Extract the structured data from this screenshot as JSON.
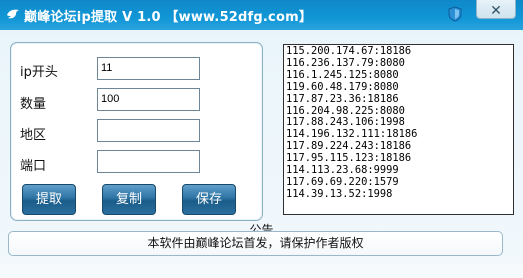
{
  "window": {
    "title": "巅峰论坛ip提取 V 1.0 【www.52dfg.com】",
    "app_icon": "bird-icon",
    "tray_icon": "shield-icon",
    "close_icon": "close-icon",
    "close_glyph": "✕"
  },
  "form": {
    "ip_prefix_label": "ip开头",
    "ip_prefix_value": "11",
    "count_label": "数量",
    "count_value": "100",
    "region_label": "地区",
    "region_value": "",
    "port_label": "端口",
    "port_value": ""
  },
  "buttons": {
    "extract": "提取",
    "copy": "复制",
    "save": "保存"
  },
  "output_lines": [
    "115.200.174.67:18186",
    "116.236.137.79:8080",
    "116.1.245.125:8080",
    "119.60.48.179:8080",
    "117.87.23.36:18186",
    "116.204.98.225:8080",
    "117.88.243.106:1998",
    "114.196.132.111:18186",
    "117.89.224.243:18186",
    "117.95.115.123:18186",
    "114.113.23.68:9999",
    "117.69.69.220:1579",
    "114.39.13.52:1998"
  ],
  "notice": {
    "title": "公告",
    "text": "本软件由巅峰论坛首发，请保护作者版权"
  }
}
